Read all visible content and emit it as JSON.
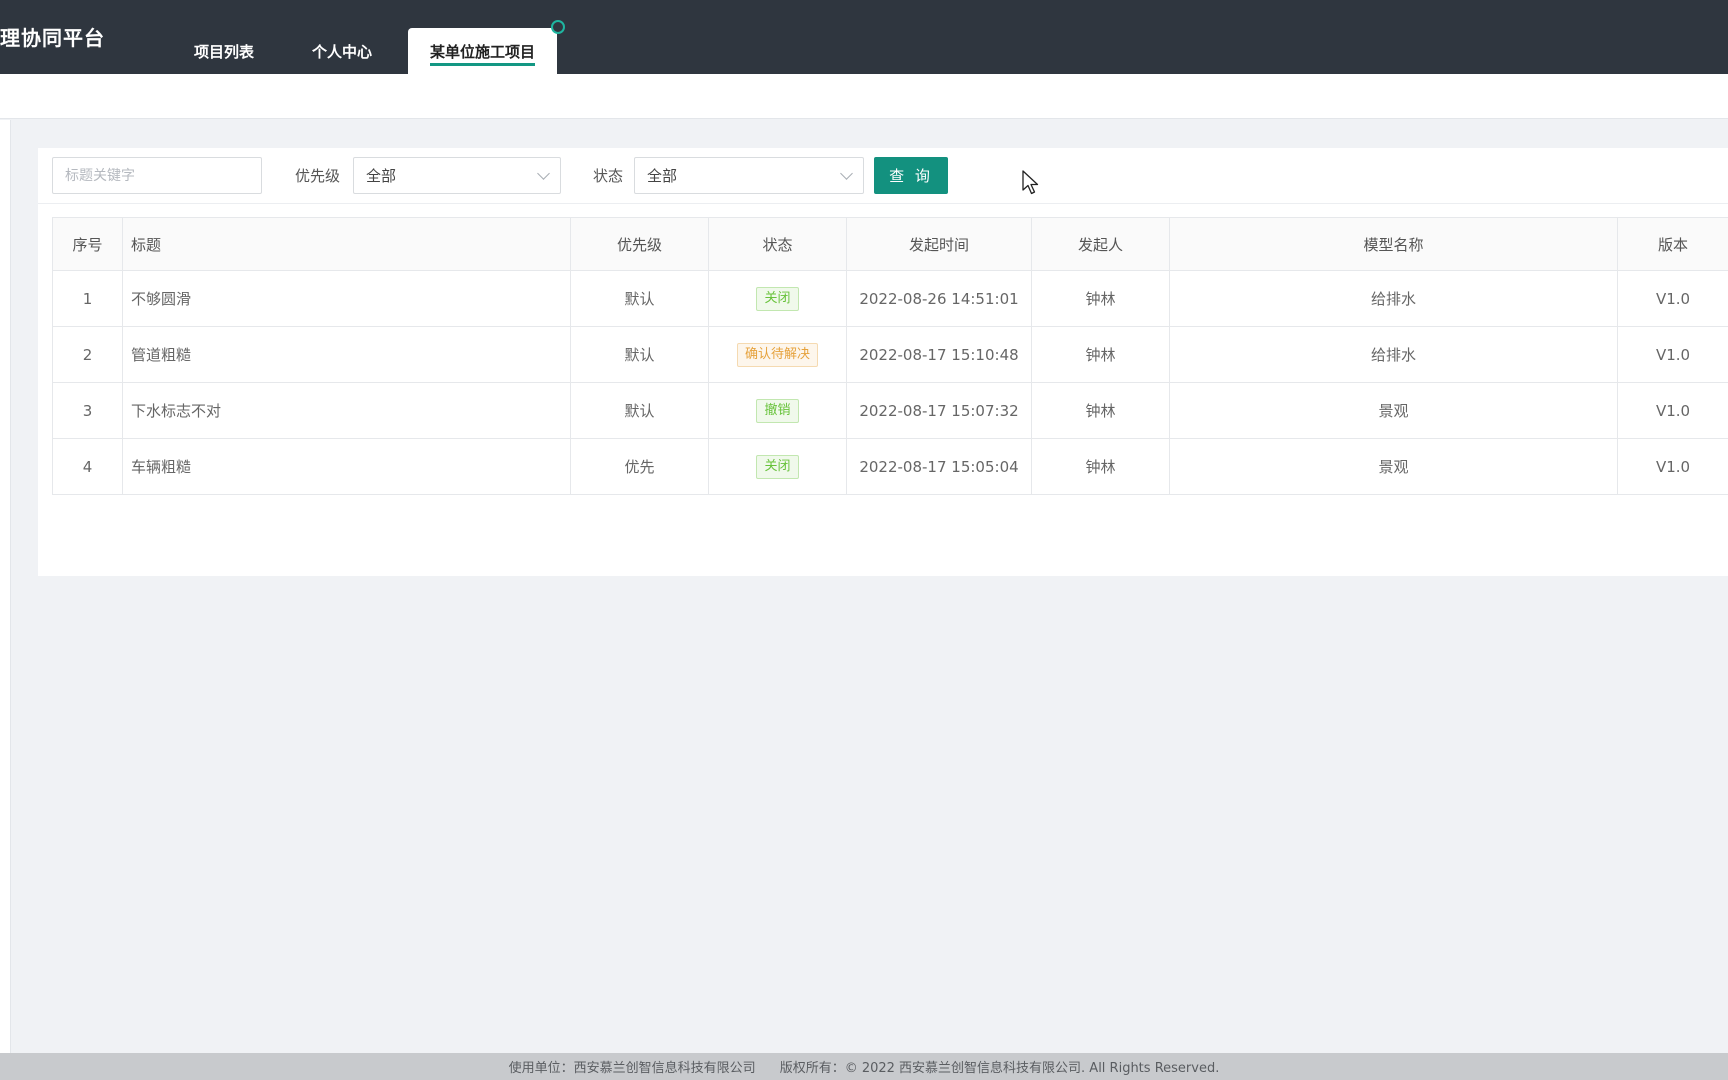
{
  "header": {
    "app_title": "理协同平台",
    "tabs": [
      {
        "label": "项目列表",
        "active": false
      },
      {
        "label": "个人中心",
        "active": false
      },
      {
        "label": "某单位施工项目",
        "active": true
      }
    ]
  },
  "filters": {
    "keyword_placeholder": "标题关键字",
    "priority_label": "优先级",
    "priority_value": "全部",
    "status_label": "状态",
    "status_value": "全部",
    "query_button": "查 询"
  },
  "table": {
    "columns": [
      "序号",
      "标题",
      "优先级",
      "状态",
      "发起时间",
      "发起人",
      "模型名称",
      "版本"
    ],
    "rows": [
      {
        "no": "1",
        "title": "不够圆滑",
        "priority": "默认",
        "status": "关闭",
        "status_color": "green",
        "time": "2022-08-26 14:51:01",
        "initiator": "钟林",
        "model": "给排水",
        "version": "V1.0"
      },
      {
        "no": "2",
        "title": "管道粗糙",
        "priority": "默认",
        "status": "确认待解决",
        "status_color": "orange",
        "time": "2022-08-17 15:10:48",
        "initiator": "钟林",
        "model": "给排水",
        "version": "V1.0"
      },
      {
        "no": "3",
        "title": "下水标志不对",
        "priority": "默认",
        "status": "撤销",
        "status_color": "green",
        "time": "2022-08-17 15:07:32",
        "initiator": "钟林",
        "model": "景观",
        "version": "V1.0"
      },
      {
        "no": "4",
        "title": "车辆粗糙",
        "priority": "优先",
        "status": "关闭",
        "status_color": "green",
        "time": "2022-08-17 15:05:04",
        "initiator": "钟林",
        "model": "景观",
        "version": "V1.0"
      }
    ]
  },
  "footer": {
    "unit": "使用单位：西安慕兰创智信息科技有限公司",
    "copyright": "版权所有：© 2022 西安慕兰创智信息科技有限公司. All Rights Reserved."
  },
  "colors": {
    "header_bg": "#2f363f",
    "accent": "#13917f",
    "tag_green": "#67c23a",
    "tag_orange": "#e6a23c"
  }
}
